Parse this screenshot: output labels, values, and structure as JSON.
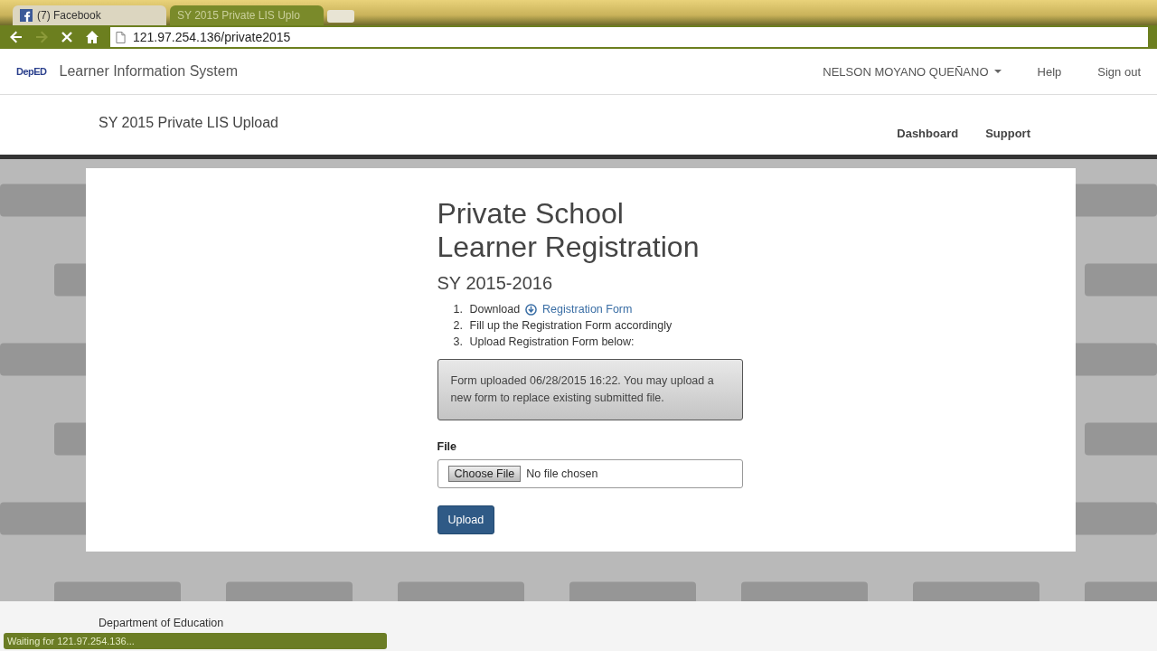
{
  "browser": {
    "tabs": [
      {
        "label": "(7) Facebook",
        "selected": false
      },
      {
        "label": "SY 2015 Private LIS Uplo",
        "selected": true
      }
    ],
    "address": "121.97.254.136/private2015",
    "status": "Waiting for 121.97.254.136..."
  },
  "navbar": {
    "logo": "DepED",
    "brand": "Learner Information System",
    "user": "NELSON MOYANO QUEÑANO",
    "links": [
      "Help",
      "Sign out"
    ]
  },
  "subheader": {
    "title": "SY 2015 Private LIS Upload",
    "links": [
      "Dashboard",
      "Support"
    ]
  },
  "main": {
    "title_lines": [
      "Private School",
      "Learner Registration"
    ],
    "subtitle": "SY 2015-2016",
    "steps": [
      {
        "number": "1.",
        "text": "Download",
        "link": "Registration Form"
      },
      {
        "number": "2.",
        "text": "Fill up the Registration Form accordingly"
      },
      {
        "number": "3.",
        "text": "Upload Registration Form below:"
      }
    ],
    "alert": "Form uploaded 06/28/2015 16:22. You may upload a new form to replace existing submitted file.",
    "file_label": "File",
    "choose_button": "Choose File",
    "file_status": "No file chosen",
    "upload_button": "Upload"
  },
  "footer": {
    "text": "Department of Education"
  }
}
